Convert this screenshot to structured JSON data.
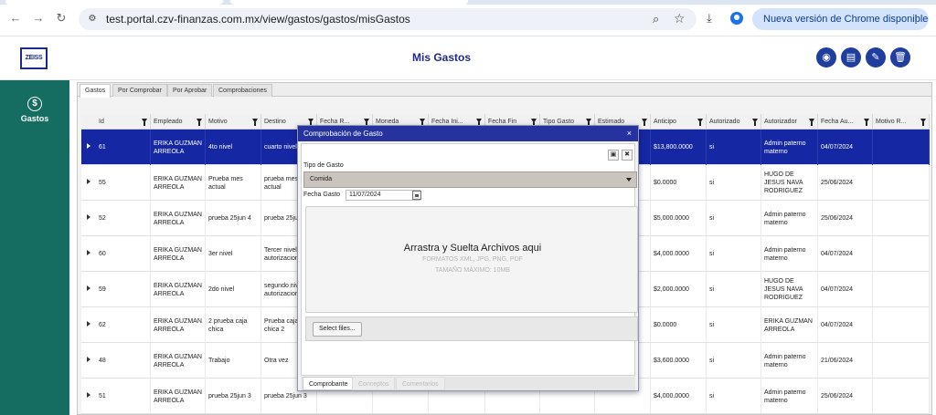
{
  "browser": {
    "url": "test.portal.czv-finanzas.com.mx/view/gastos/gastos/misGastos",
    "update_label": "Nueva versión de Chrome disponible"
  },
  "header": {
    "logo_text": "ZEISS",
    "title": "Mis Gastos"
  },
  "sidebar": {
    "items": [
      {
        "label": "Gastos"
      }
    ]
  },
  "tabs": [
    "Gastos",
    "Por Comprobar",
    "Por Aprobar",
    "Comprobaciones"
  ],
  "table": {
    "columns": [
      "Id",
      "Empleado",
      "Motivo",
      "Destino",
      "Fecha R...",
      "Moneda",
      "Fecha Ini...",
      "Fecha Fin",
      "Tipo Gasto",
      "Estimado",
      "Anticipo",
      "Autorizado",
      "Autorizador",
      "Fecha Au...",
      "Motivo R..."
    ],
    "rows": [
      {
        "id": "61",
        "empleado": "ERIKA GUZMAN ARREOLA",
        "motivo": "4to nivel",
        "destino": "cuarto nivel",
        "anticipo": "$13,800.0000",
        "autorizado": "si",
        "autorizador": "Admin paterno materno",
        "fecha_au": "04/07/2024"
      },
      {
        "id": "55",
        "empleado": "ERIKA GUZMAN ARREOLA",
        "motivo": "Prueba mes actual",
        "destino": "prueba mes actual",
        "anticipo": "$0.0000",
        "autorizado": "si",
        "autorizador": "HUGO DE JESUS NAVA RODRIGUEZ",
        "fecha_au": "25/06/2024"
      },
      {
        "id": "52",
        "empleado": "ERIKA GUZMAN ARREOLA",
        "motivo": "prueba 25jun 4",
        "destino": "prueba 25jun",
        "anticipo": "$5,000.0000",
        "autorizado": "si",
        "autorizador": "Admin paterno materno",
        "fecha_au": "25/06/2024"
      },
      {
        "id": "60",
        "empleado": "ERIKA GUZMAN ARREOLA",
        "motivo": "3er nivel",
        "destino": "Tercer nivel autorizacion",
        "anticipo": "$4,000.0000",
        "autorizado": "si",
        "autorizador": "Admin paterno materno",
        "fecha_au": "04/07/2024"
      },
      {
        "id": "59",
        "empleado": "ERIKA GUZMAN ARREOLA",
        "motivo": "2do nivel",
        "destino": "segundo nivel autorizacion",
        "anticipo": "$2,000.0000",
        "autorizado": "si",
        "autorizador": "HUGO DE JESUS NAVA RODRIGUEZ",
        "fecha_au": "04/07/2024"
      },
      {
        "id": "62",
        "empleado": "ERIKA GUZMAN ARREOLA",
        "motivo": "2 prueba caja chica",
        "destino": "Prueba caja chica 2",
        "anticipo": "$0.0000",
        "autorizado": "si",
        "autorizador": "ERIKA GUZMAN ARREOLA",
        "fecha_au": "04/07/2024"
      },
      {
        "id": "48",
        "empleado": "ERIKA GUZMAN ARREOLA",
        "motivo": "Trabajo",
        "destino": "Otra vez",
        "anticipo": "$3,600.0000",
        "autorizado": "si",
        "autorizador": "Admin paterno materno",
        "fecha_au": "21/06/2024"
      },
      {
        "id": "51",
        "empleado": "ERIKA GUZMAN ARREOLA",
        "motivo": "prueba 25jun 3",
        "destino": "prueba 25jun 3",
        "anticipo": "$4,000.0000",
        "autorizado": "si",
        "autorizador": "Admin paterno materno",
        "fecha_au": "25/06/2024"
      }
    ]
  },
  "modal": {
    "title": "Comprobación de Gasto",
    "close": "×",
    "tipo_label": "Tipo de Gasto",
    "tipo_value": "Comida",
    "fecha_label": "Fecha Gasto",
    "fecha_value": "11/07/2024",
    "dropzone_title": "Arrastra y Suelta Archivos aqui",
    "dropzone_formats": "FORMATOS XML, JPG, PNG, PDF",
    "dropzone_size": "TAMAÑO MÁXIMO: 10MB",
    "select_files": "Select files...",
    "tabs": [
      "Comprobante",
      "Conceptos",
      "Comentarios"
    ]
  },
  "colors": {
    "sidebar": "#156c60",
    "selected_row": "#1627a3",
    "modal_title": "#26339e",
    "accent_button": "#1f3e9e"
  }
}
